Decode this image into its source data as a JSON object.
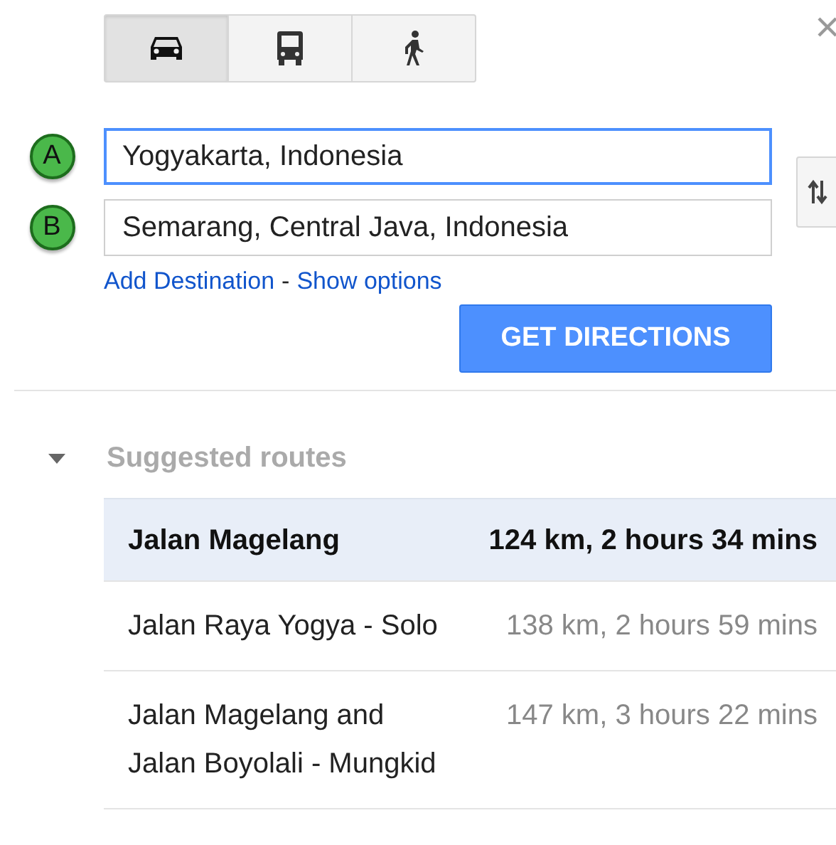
{
  "travel_modes": [
    {
      "kind": "car",
      "selected": true
    },
    {
      "kind": "bus",
      "selected": false
    },
    {
      "kind": "walk",
      "selected": false
    }
  ],
  "waypoints": [
    {
      "marker": "A",
      "value": "Yogyakarta, Indonesia",
      "focused": true
    },
    {
      "marker": "B",
      "value": "Semarang, Central Java, Indonesia",
      "focused": false
    }
  ],
  "links": {
    "add": "Add Destination",
    "separator": "-",
    "options": "Show options"
  },
  "get_directions_button": "GET DIRECTIONS",
  "suggested_routes": {
    "title": "Suggested routes",
    "expanded": true,
    "routes": [
      {
        "name": "Jalan Magelang",
        "summary": "124 km, 2 hours 34 mins",
        "selected": true
      },
      {
        "name": "Jalan Raya Yogya - Solo",
        "summary": "138 km, 2 hours 59 mins",
        "selected": false
      },
      {
        "name": "Jalan Magelang and Jalan Boyolali - Mungkid",
        "summary": "147 km, 3 hours 22 mins",
        "selected": false
      }
    ]
  }
}
